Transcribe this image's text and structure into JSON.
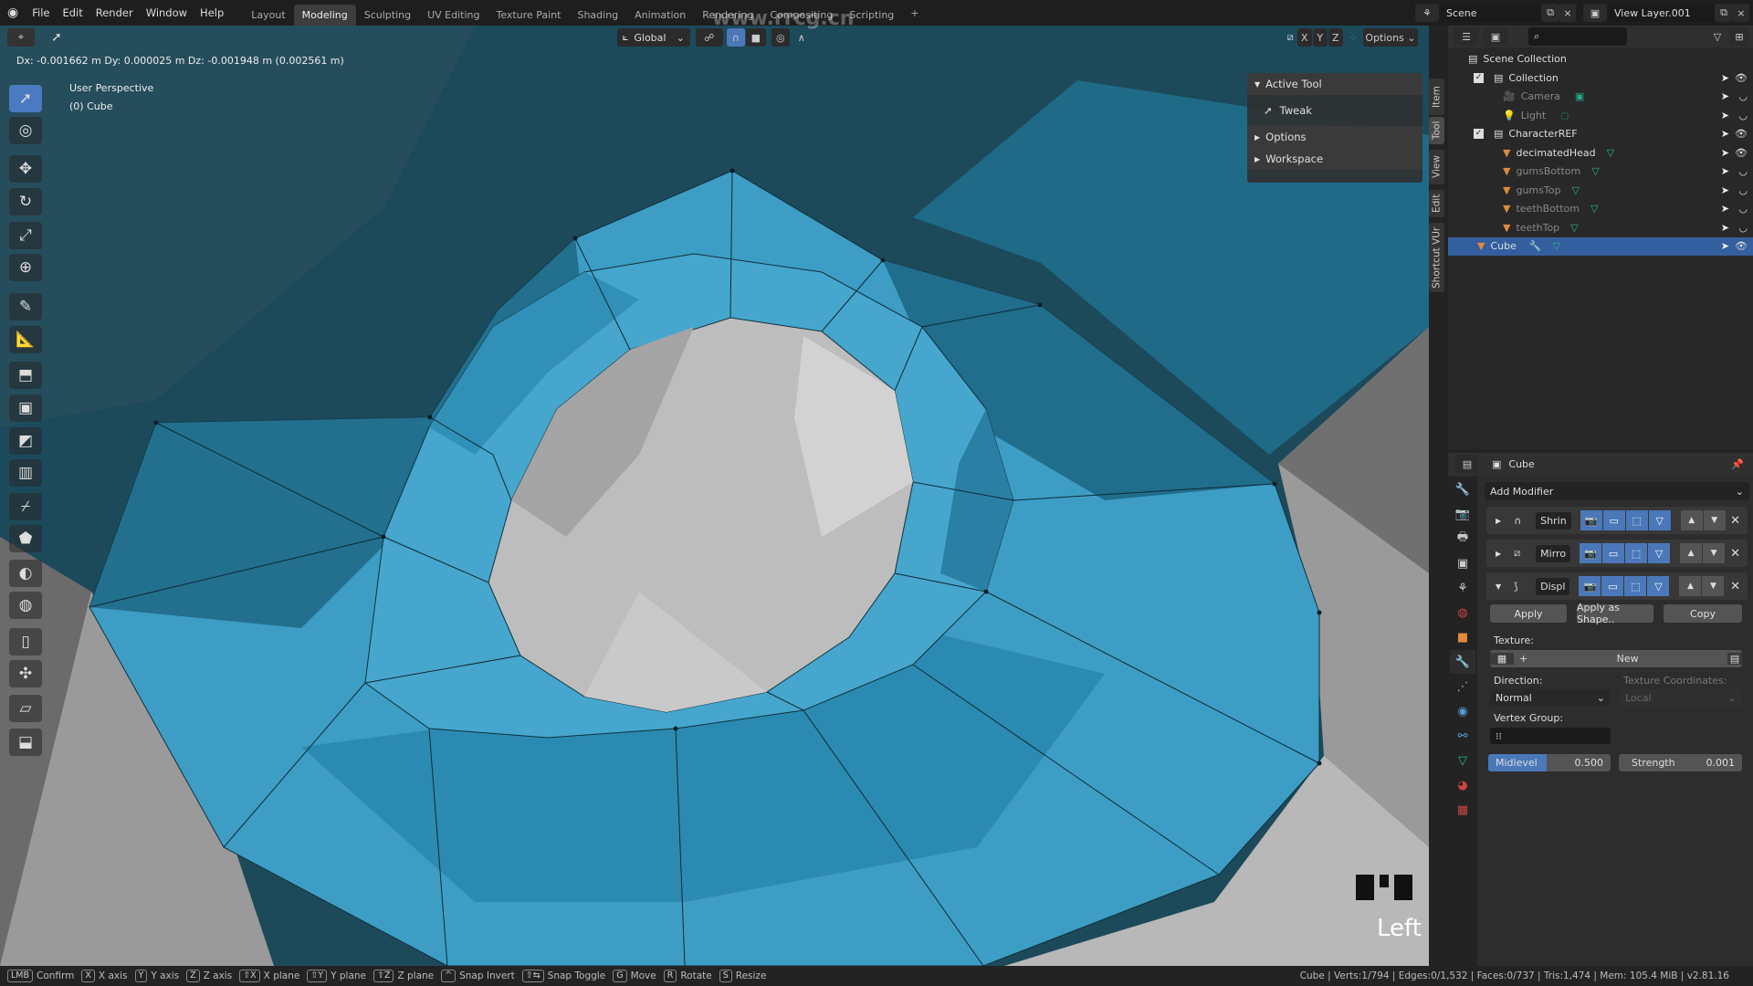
{
  "topbar": {
    "menus": [
      "File",
      "Edit",
      "Render",
      "Window",
      "Help"
    ],
    "workspaces": [
      "Layout",
      "Modeling",
      "Sculpting",
      "UV Editing",
      "Texture Paint",
      "Shading",
      "Animation",
      "Rendering",
      "Compositing",
      "Scripting"
    ],
    "active_workspace": "Modeling",
    "add_tab": "+",
    "scene": "Scene",
    "view_layer": "View Layer.001"
  },
  "watermark": "www.rrcg.cn",
  "viewport": {
    "transform_orientation": "Global",
    "options_label": "Options",
    "axes": [
      "X",
      "Y",
      "Z"
    ],
    "delta_readout": "Dx: -0.001662 m  Dy: 0.000025 m  Dz: -0.001948 m (0.002561 m)",
    "view_name": "User Perspective",
    "object_name": "(0) Cube",
    "view_direction": "Left",
    "tools": [
      "tweak",
      "cursor",
      "move",
      "rotate",
      "scale",
      "transform",
      "annotate",
      "measure",
      "extrude",
      "inset",
      "bevel",
      "loop-cut",
      "knife",
      "poly-build",
      "spin",
      "smooth",
      "edge-slide",
      "shrink-fatten",
      "shear",
      "rip"
    ]
  },
  "npanel": {
    "active_tool": "Active Tool",
    "tool": "Tweak",
    "options": "Options",
    "workspace": "Workspace",
    "tabs": [
      "Item",
      "Tool",
      "View",
      "Edit",
      "Shortcut VUr"
    ]
  },
  "outliner": {
    "root": "Scene Collection",
    "items": [
      {
        "name": "Collection",
        "type": "collection",
        "dim": false
      },
      {
        "name": "Camera",
        "type": "camera",
        "dim": true
      },
      {
        "name": "Light",
        "type": "light",
        "dim": true
      },
      {
        "name": "CharacterREF",
        "type": "collection",
        "dim": false
      },
      {
        "name": "decimatedHead",
        "type": "mesh",
        "dim": false
      },
      {
        "name": "gumsBottom",
        "type": "mesh",
        "dim": true
      },
      {
        "name": "gumsTop",
        "type": "mesh",
        "dim": true
      },
      {
        "name": "teethBottom",
        "type": "mesh",
        "dim": true
      },
      {
        "name": "teethTop",
        "type": "mesh",
        "dim": true
      },
      {
        "name": "Cube",
        "type": "mesh",
        "dim": false,
        "selected": true
      }
    ]
  },
  "properties": {
    "object": "Cube",
    "add_modifier": "Add Modifier",
    "modifiers": [
      {
        "name": "Shrin",
        "expanded": false
      },
      {
        "name": "Mirro",
        "expanded": false
      },
      {
        "name": "Displ",
        "expanded": true
      }
    ],
    "apply": "Apply",
    "apply_shape": "Apply as Shape..",
    "copy": "Copy",
    "texture_label": "Texture:",
    "texture_new": "New",
    "direction_label": "Direction:",
    "direction": "Normal",
    "texcoords_label": "Texture Coordinates:",
    "texcoords": "Local",
    "vertex_group_label": "Vertex Group:",
    "midlevel_label": "Midlevel",
    "midlevel": "0.500",
    "strength_label": "Strength",
    "strength": "0.001"
  },
  "status": {
    "hints": [
      [
        "LMB",
        "Confirm"
      ],
      [
        "X",
        "X axis"
      ],
      [
        "Y",
        "Y axis"
      ],
      [
        "Z",
        "Z axis"
      ],
      [
        "⇧X",
        "X plane"
      ],
      [
        "⇧Y",
        "Y plane"
      ],
      [
        "⇧Z",
        "Z plane"
      ],
      [
        "^",
        "Snap Invert"
      ],
      [
        "⇧⇆",
        "Snap Toggle"
      ],
      [
        "G",
        "Move"
      ],
      [
        "R",
        "Rotate"
      ],
      [
        "S",
        "Resize"
      ]
    ],
    "stats": "Cube | Verts:1/794 | Edges:0/1,532 | Faces:0/737 | Tris:1,474 | Mem: 105.4 MiB | v2.81.16"
  },
  "colors": {
    "accent": "#4a78b8",
    "mesh_blue": "#3b9cc4",
    "selected_row": "#335f9e"
  }
}
